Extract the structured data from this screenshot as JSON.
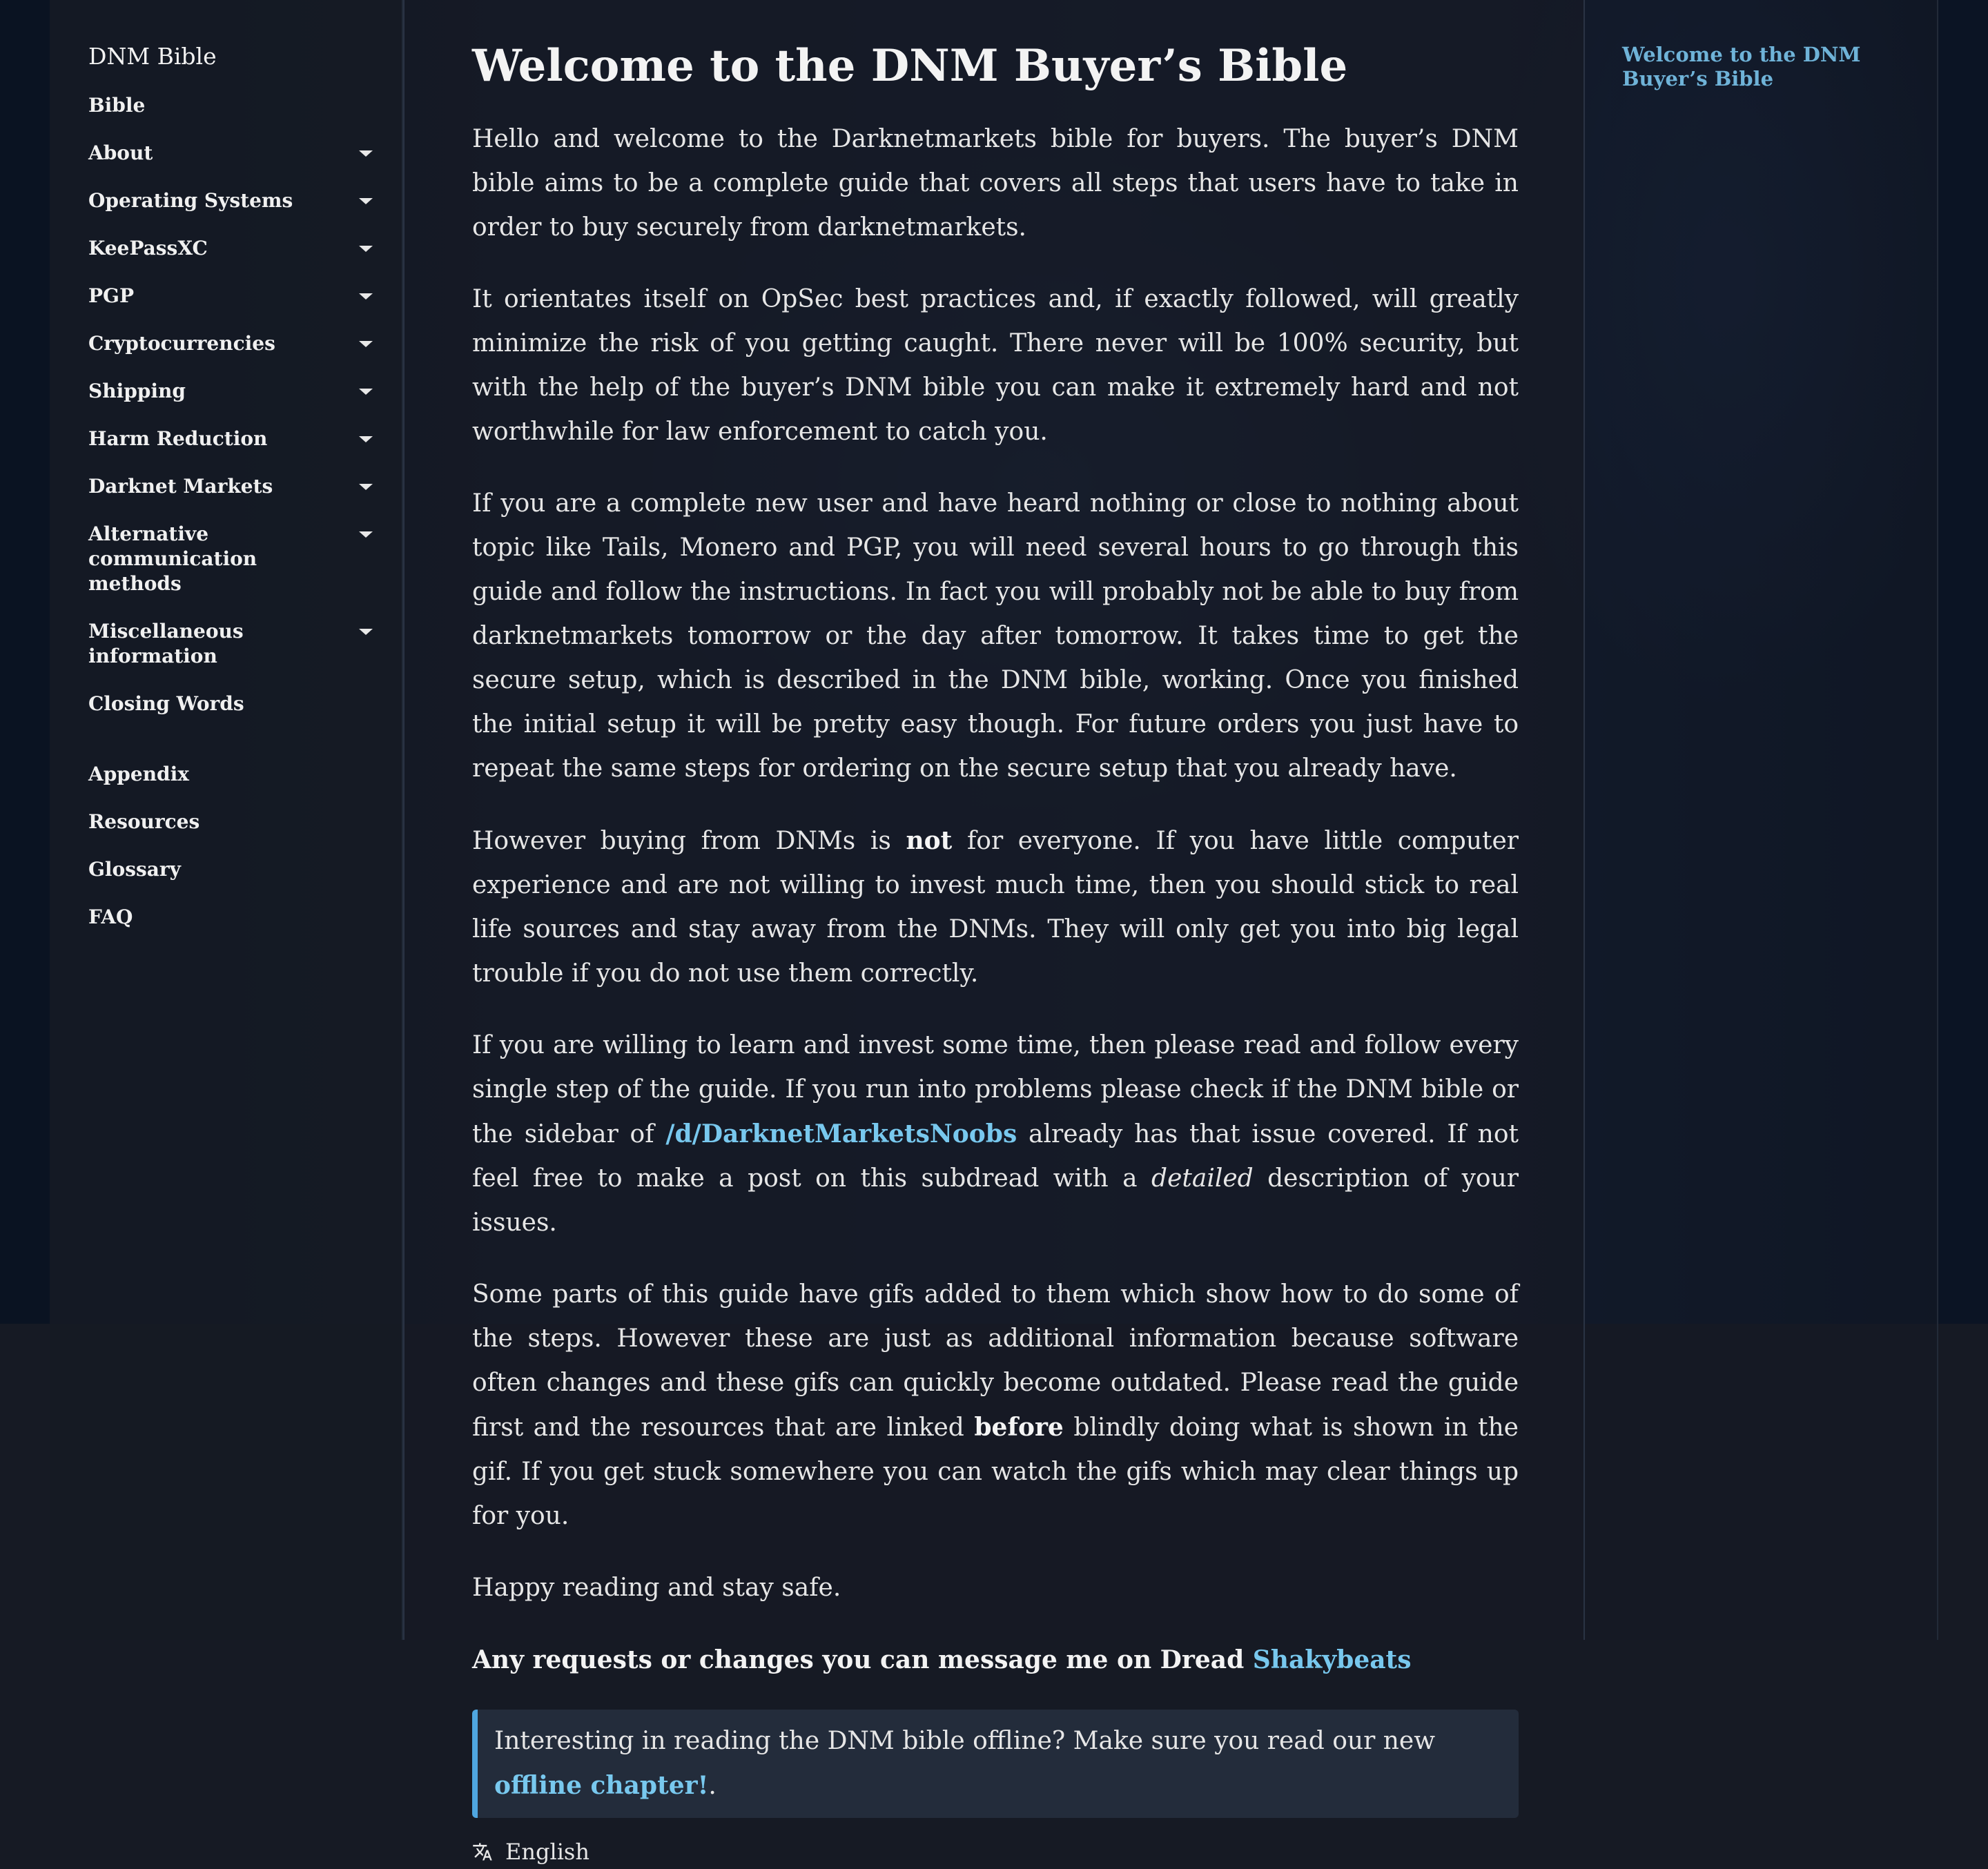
{
  "sidebar": {
    "title": "DNM Bible",
    "items": [
      {
        "label": "Bible",
        "expandable": false
      },
      {
        "label": "About",
        "expandable": true
      },
      {
        "label": "Operating Systems",
        "expandable": true
      },
      {
        "label": "KeePassXC",
        "expandable": true
      },
      {
        "label": "PGP",
        "expandable": true
      },
      {
        "label": "Cryptocurrencies",
        "expandable": true
      },
      {
        "label": "Shipping",
        "expandable": true
      },
      {
        "label": "Harm Reduction",
        "expandable": true
      },
      {
        "label": "Darknet Markets",
        "expandable": true
      },
      {
        "label": "Alternative communication methods",
        "expandable": true
      },
      {
        "label": "Miscellaneous information",
        "expandable": true
      },
      {
        "label": "Closing Words",
        "expandable": false
      }
    ],
    "secondary_items": [
      {
        "label": "Appendix"
      },
      {
        "label": "Resources"
      },
      {
        "label": "Glossary"
      },
      {
        "label": "FAQ"
      }
    ]
  },
  "main": {
    "title": "Welcome to the DNM Buyer’s Bible",
    "p1": "Hello and welcome to the Darknetmarkets bible for buyers. The buyer’s DNM bible aims to be a complete guide that covers all steps that users have to take in order to buy securely from darknetmarkets.",
    "p2": "It orientates itself on OpSec best practices and, if exactly followed, will greatly minimize the risk of you getting caught. There never will be 100% security, but with the help of the buyer’s DNM bible you can make it extremely hard and not worthwhile for law enforcement to catch you.",
    "p3": "If you are a complete new user and have heard nothing or close to nothing about topic like Tails, Monero and PGP, you will need several hours to go through this guide and follow the instructions. In fact you will probably not be able to buy from darknetmarkets tomorrow or the day after tomorrow. It takes time to get the secure setup, which is described in the DNM bible, working. Once you finished the initial setup it will be pretty easy though. For future orders you just have to repeat the same steps for ordering on the secure setup that you already have.",
    "p4": {
      "before": "However buying from DNMs is ",
      "strong": "not",
      "after": " for everyone. If you have little computer experience and are not willing to invest much time, then you should stick to real life sources and stay away from the DNMs. They will only get you into big legal trouble if you do not use them correctly."
    },
    "p5": {
      "before": "If you are willing to learn and invest some time, then please read and follow every single step of the guide. If you run into problems please check if the DNM bible or the sidebar of ",
      "link": "/d/DarknetMarketsNoobs",
      "middle": " already has that issue covered. If not feel free to make a post on this subdread with a ",
      "em": "detailed",
      "after": " description of your issues."
    },
    "p6": {
      "before": "Some parts of this guide have gifs added to them which show how to do some of the steps. However these are just as additional information because software often changes and these gifs can quickly become outdated. Please read the guide first and the resources that are linked ",
      "strong": "before",
      "after": " blindly doing what is shown in the gif. If you get stuck somewhere you can watch the gifs which may clear things up for you."
    },
    "p7": "Happy reading and stay safe.",
    "request": {
      "text": "Any requests or changes you can message me on Dread ",
      "link": "Shakybeats"
    },
    "notice": {
      "text": "Interesting in reading the DNM bible offline? Make sure you read our new ",
      "link": "offline chapter!",
      "after": "."
    },
    "language": "English"
  },
  "toc": {
    "items": [
      "Welcome to the DNM Buyer’s Bible"
    ]
  }
}
